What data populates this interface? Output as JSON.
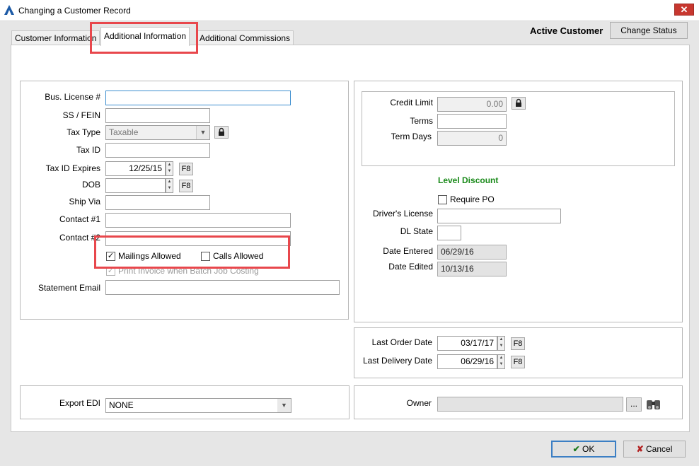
{
  "window": {
    "title": "Changing a Customer Record",
    "close_label": "✕"
  },
  "tabs": [
    "Customer Information",
    "Additional Information",
    "Additional Commissions"
  ],
  "header": {
    "status": "Active Customer",
    "change_status_label": "Change Status"
  },
  "left": {
    "bus_license": {
      "label": "Bus. License #",
      "value": ""
    },
    "ss_fein": {
      "label": "SS / FEIN",
      "value": ""
    },
    "tax_type": {
      "label": "Tax Type",
      "value": "Taxable"
    },
    "tax_id": {
      "label": "Tax ID",
      "value": ""
    },
    "tax_id_expires": {
      "label": "Tax ID Expires",
      "value": "12/25/15"
    },
    "dob": {
      "label": "DOB",
      "value": ""
    },
    "ship_via": {
      "label": "Ship Via",
      "value": ""
    },
    "contact1": {
      "label": "Contact #1",
      "value": ""
    },
    "contact2": {
      "label": "Contact #2",
      "value": ""
    },
    "mailings_allowed": {
      "label": "Mailings Allowed",
      "checked": true
    },
    "calls_allowed": {
      "label": "Calls Allowed",
      "checked": false
    },
    "print_invoice": {
      "label": "Print Invoice when Batch Job Costing",
      "checked": true
    },
    "statement_email": {
      "label": "Statement Email",
      "value": ""
    },
    "f8": "F8"
  },
  "right": {
    "credit_limit": {
      "label": "Credit Limit",
      "value": "0.00"
    },
    "terms": {
      "label": "Terms",
      "value": ""
    },
    "term_days": {
      "label": "Term Days",
      "value": "0"
    },
    "level_discount": "Level Discount",
    "require_po": {
      "label": "Require PO",
      "checked": false
    },
    "drivers_license": {
      "label": "Driver's License",
      "value": ""
    },
    "dl_state": {
      "label": "DL State",
      "value": ""
    },
    "date_entered": {
      "label": "Date Entered",
      "value": "06/29/16"
    },
    "date_edited": {
      "label": "Date Edited",
      "value": "10/13/16"
    },
    "last_order_date": {
      "label": "Last Order Date",
      "value": "03/17/17"
    },
    "last_delivery_date": {
      "label": "Last Delivery Date",
      "value": "06/29/16"
    }
  },
  "export_edi": {
    "label": "Export EDI",
    "value": "NONE"
  },
  "owner": {
    "label": "Owner",
    "value": "",
    "browse_label": "..."
  },
  "footer": {
    "ok_label": "OK",
    "cancel_label": "Cancel"
  },
  "colors": {
    "highlight": "#e8474c",
    "level_discount": "#1a8a1a",
    "close": "#c7372f"
  }
}
